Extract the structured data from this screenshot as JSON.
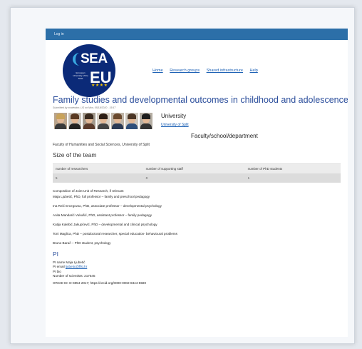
{
  "topbar": {
    "login": "Log in"
  },
  "logo": {
    "sea": "SEA",
    "eu": "EU",
    "small": "European University of the Seas"
  },
  "nav": [
    "Home",
    "Research groups",
    "Shared infrastructure",
    "Help"
  ],
  "title": "Family studies and developmental outcomes in childhood and adolescence",
  "submitted": "Submitted by moderator_US on Mon, 05/18/2020 - 15:57",
  "university": {
    "label": "University",
    "link": "University of Split"
  },
  "faculty": {
    "label": "Faculty/school/department",
    "value": "Faculty of Humanities and Social Sciences, University of Split"
  },
  "team": {
    "heading": "Size of the team",
    "headers": [
      "number of researchers",
      "number of supporting staff",
      "number of PhD students"
    ],
    "values": [
      "5",
      "0",
      "1"
    ]
  },
  "composition": [
    "Composition of Joint Unit of Research, if relevant",
    "Maja Ljubetić, PhD, full professor – family and preschool pedagogy",
    "Ina Reić Ercegovac, PhD, associate professor – developmental psychology",
    "Anita Mandarić Vukušić, PhD, assistant professor – family pedagogy",
    "Katija Kalebić Jakupčević, PhD – developmental and clinical psychology",
    "Toni Maglica, PhD – postdoctoral researcher, special education- behavioural problems",
    "Bruno Barač – PhD student, psychology"
  ],
  "pi": {
    "heading": "PI",
    "name": "PI name Maja Ljubetić",
    "email_label": "PI email",
    "email": "ljubetic@ffst.hr",
    "bio": "PI bio",
    "scientists": "Number of scientists: 217545",
    "orcid": "ORCID ID: D-6954-2017; https://orcid.org/0000-0002-8344-5580"
  }
}
